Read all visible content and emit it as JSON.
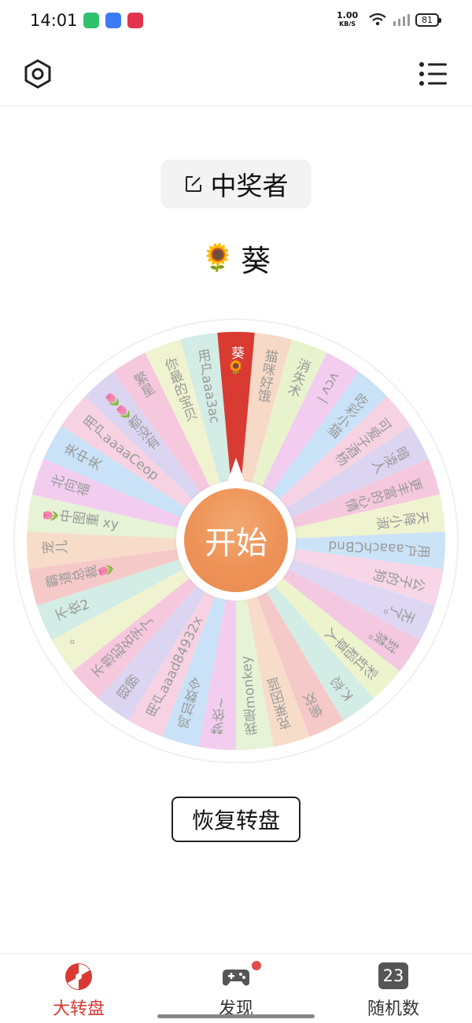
{
  "status_bar": {
    "time": "14:01",
    "net_speed": "1.00",
    "net_unit": "KB/S",
    "battery": "81",
    "app_icons": [
      {
        "name": "battery-app-icon",
        "color": "#2fc26e"
      },
      {
        "name": "browser-app-icon",
        "color": "#3a7bf4"
      },
      {
        "name": "shopping-app-icon",
        "color": "#e3344f"
      }
    ]
  },
  "header": {
    "settings_icon": "hexagon-gear-icon",
    "menu_icon": "list-menu-icon"
  },
  "winner": {
    "label": "中奖者",
    "name": "葵",
    "emoji": "🌻"
  },
  "wheel": {
    "start_label": "开始",
    "segments": [
      {
        "label": "葵🌻",
        "color": "#d93a32"
      },
      {
        "label": "猫咪好饿",
        "color": "#f6d9c6"
      },
      {
        "label": "消失术",
        "color": "#e8f2cc"
      },
      {
        "label": "vcv一",
        "color": "#f2cdf0"
      },
      {
        "label": "吃彩小猫",
        "color": "#c9e2f7"
      },
      {
        "label": "可爱子酒杨",
        "color": "#f7d2e2"
      },
      {
        "label": "暗凌人",
        "color": "#dcd5f2"
      },
      {
        "label": "更丰富的心情",
        "color": "#f6c8de"
      },
      {
        "label": "天降小淑",
        "color": "#eff3cf"
      },
      {
        "label": "用户aaachCBnd",
        "color": "#cbe3f7"
      },
      {
        "label": "公子的狗",
        "color": "#f7d6e8"
      },
      {
        "label": "无了。",
        "color": "#ddd7f3"
      },
      {
        "label": "封禁。",
        "color": "#f3c8e0"
      },
      {
        "label": "彩虹稻草人",
        "color": "#ecf3cd"
      },
      {
        "label": "K.恋",
        "color": "#d3ece5"
      },
      {
        "label": "偷欢",
        "color": "#f6c9c9"
      },
      {
        "label": "克莱因蓝",
        "color": "#f7ddc9"
      },
      {
        "label": "我是monkey",
        "color": "#e6f3d6"
      },
      {
        "label": "梦依~",
        "color": "#f2cdf0"
      },
      {
        "label": "鸡加数令",
        "color": "#c9e2f7"
      },
      {
        "label": "用户aaad84932x",
        "color": "#f7d2e2"
      },
      {
        "label": "翅膀",
        "color": "#dcd5f2"
      },
      {
        "label": "不想起名字了",
        "color": "#f6c8de"
      },
      {
        "label": "。",
        "color": "#eff3cf"
      },
      {
        "label": "不依2",
        "color": "#d3ece5"
      },
      {
        "label": "霸道总裁🌷",
        "color": "#f6c9c9"
      },
      {
        "label": "宠儿",
        "color": "#f7ddc9"
      },
      {
        "label": "🌷中图重 xy",
        "color": "#e6f3d6"
      },
      {
        "label": "北向福",
        "color": "#f2cdf0"
      },
      {
        "label": "夹中夹",
        "color": "#c9e2f7"
      },
      {
        "label": "用户aaaaCeop",
        "color": "#f7d2e2"
      },
      {
        "label": "🌷🌷都没有",
        "color": "#dcd5f2"
      },
      {
        "label": "繁星",
        "color": "#f6c8de"
      },
      {
        "label": "你最的宝贝",
        "color": "#eff3cf"
      },
      {
        "label": "用户aaa3ac",
        "color": "#d3ece5"
      }
    ]
  },
  "reset_label": "恢复转盘",
  "bottom_nav": [
    {
      "label": "大转盘",
      "icon": "wheel-icon",
      "active": true
    },
    {
      "label": "发现",
      "icon": "gamepad-icon",
      "active": false
    },
    {
      "label": "随机数",
      "icon": "number-icon",
      "active": false,
      "badge": "23"
    }
  ],
  "colors": {
    "active": "#d93a32",
    "inactive": "#333333",
    "start_button": "#ee9257"
  }
}
